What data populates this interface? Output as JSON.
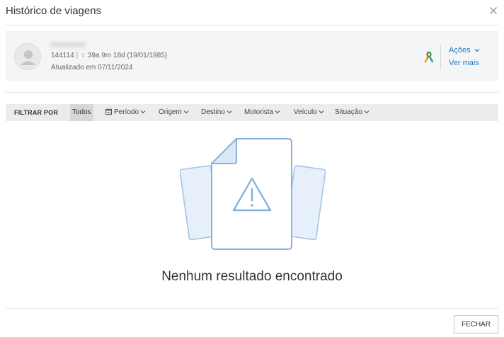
{
  "modal": {
    "title": "Histórico de viagens",
    "close_icon": "close-icon"
  },
  "patient": {
    "name": "xxxxxxxxx",
    "id": "144114",
    "separator": "|",
    "gender_icon": "female-icon",
    "age": "39a 9m 18d (19/01/1985)",
    "updated": "Atualizado em 07/11/2024",
    "ribbon_icon": "awareness-ribbon-icon",
    "actions_label": "Ações",
    "see_more_label": "Ver mais"
  },
  "filters": {
    "label": "FILTRAR POR",
    "active": "Todos",
    "items": [
      "Período",
      "Origem",
      "Destino",
      "Motorista",
      "Veículo",
      "Situação"
    ],
    "period_icon": "calendar-icon"
  },
  "empty_state": {
    "message": "Nenhum resultado encontrado",
    "icon": "warning-document-icon"
  },
  "footer": {
    "close_button": "FECHAR"
  },
  "colors": {
    "accent": "#2a7ac0",
    "filter_bar": "#ebecee",
    "card_bg": "#f4f5f6",
    "illustration_stroke": "#90b8e0"
  }
}
